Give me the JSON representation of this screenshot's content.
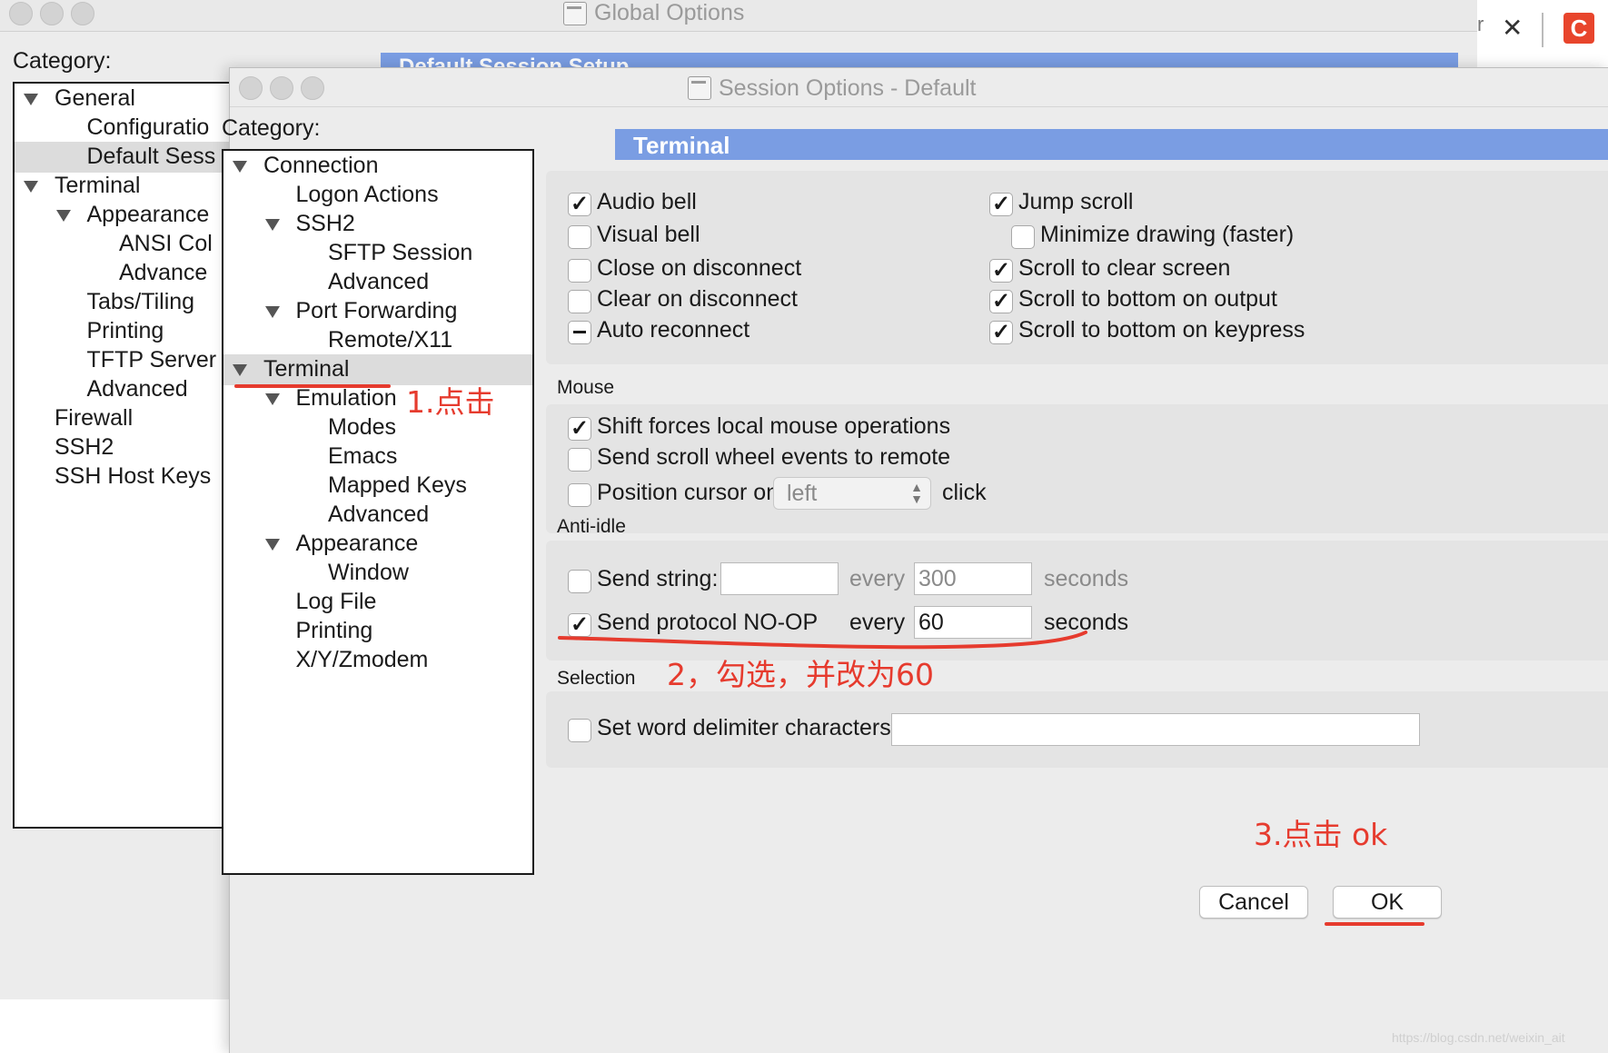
{
  "global_window": {
    "title": "Global Options",
    "category_label": "Category:",
    "header": "Default Session Setup",
    "tree": [
      {
        "label": "General",
        "expanded": true,
        "level": 0
      },
      {
        "label": "Configuratio",
        "level": 1
      },
      {
        "label": "Default Sess",
        "level": 1,
        "selected": true
      },
      {
        "label": "Terminal",
        "expanded": true,
        "level": 0
      },
      {
        "label": "Appearance",
        "expanded": true,
        "level": 1
      },
      {
        "label": "ANSI Col",
        "level": 2
      },
      {
        "label": "Advance",
        "level": 2
      },
      {
        "label": "Tabs/Tiling",
        "level": 1
      },
      {
        "label": "Printing",
        "level": 1
      },
      {
        "label": "TFTP Server",
        "level": 1
      },
      {
        "label": "Advanced",
        "level": 1
      },
      {
        "label": "Firewall",
        "level": 0
      },
      {
        "label": "SSH2",
        "level": 0
      },
      {
        "label": "SSH Host Keys",
        "level": 0
      }
    ]
  },
  "edge": {
    "fragment": "r",
    "close_glyph": "✕",
    "app_letter": "C"
  },
  "dialog": {
    "title": "Session Options - Default",
    "category_label": "Category:",
    "tree": [
      {
        "label": "Connection",
        "expanded": true,
        "level": 0
      },
      {
        "label": "Logon Actions",
        "level": 1
      },
      {
        "label": "SSH2",
        "expanded": true,
        "level": 1
      },
      {
        "label": "SFTP Session",
        "level": 2
      },
      {
        "label": "Advanced",
        "level": 2
      },
      {
        "label": "Port Forwarding",
        "expanded": true,
        "level": 1
      },
      {
        "label": "Remote/X11",
        "level": 2
      },
      {
        "label": "Terminal",
        "expanded": true,
        "level": 0,
        "selected": true
      },
      {
        "label": "Emulation",
        "expanded": true,
        "level": 1
      },
      {
        "label": "Modes",
        "level": 2
      },
      {
        "label": "Emacs",
        "level": 2
      },
      {
        "label": "Mapped Keys",
        "level": 2
      },
      {
        "label": "Advanced",
        "level": 2
      },
      {
        "label": "Appearance",
        "expanded": true,
        "level": 1
      },
      {
        "label": "Window",
        "level": 2
      },
      {
        "label": "Log File",
        "level": 1
      },
      {
        "label": "Printing",
        "level": 1
      },
      {
        "label": "X/Y/Zmodem",
        "level": 1
      }
    ],
    "panel_title": "Terminal",
    "terminal_options_left": [
      {
        "label": "Audio bell",
        "state": "checked"
      },
      {
        "label": "Visual bell",
        "state": "unchecked"
      },
      {
        "label": "Close on disconnect",
        "state": "unchecked"
      },
      {
        "label": "Clear on disconnect",
        "state": "unchecked"
      },
      {
        "label": "Auto reconnect",
        "state": "mixed"
      }
    ],
    "terminal_options_right": [
      {
        "label": "Jump scroll",
        "state": "checked"
      },
      {
        "label": "Minimize drawing (faster)",
        "state": "unchecked",
        "indent": true
      },
      {
        "label": "Scroll to clear screen",
        "state": "checked"
      },
      {
        "label": "Scroll to bottom on output",
        "state": "checked"
      },
      {
        "label": "Scroll to bottom on keypress",
        "state": "checked"
      }
    ],
    "mouse": {
      "label": "Mouse",
      "shift_forces": {
        "label": "Shift forces local mouse operations",
        "state": "checked"
      },
      "send_scroll": {
        "label": "Send scroll wheel events to remote",
        "state": "unchecked"
      },
      "position_cursor": {
        "label": "Position cursor on",
        "state": "unchecked",
        "select_value": "left",
        "suffix": "click"
      }
    },
    "anti_idle": {
      "label": "Anti-idle",
      "send_string": {
        "label": "Send string:",
        "state": "unchecked",
        "value": "",
        "every": "every",
        "seconds_value": "300",
        "seconds": "seconds"
      },
      "send_noop": {
        "label": "Send protocol NO-OP",
        "state": "checked",
        "every": "every",
        "seconds_value": "60",
        "seconds": "seconds"
      }
    },
    "selection": {
      "label": "Selection",
      "delimiter": {
        "label": "Set word delimiter characters:",
        "state": "unchecked",
        "value": ""
      }
    },
    "buttons": {
      "cancel": "Cancel",
      "ok": "OK"
    }
  },
  "annotations": {
    "step1": "1.点击",
    "step2": "2，勾选，并改为60",
    "step3": "3.点击 ok",
    "color": "#e63b2e"
  },
  "watermark": "https://blog.csdn.net/weixin_ait"
}
